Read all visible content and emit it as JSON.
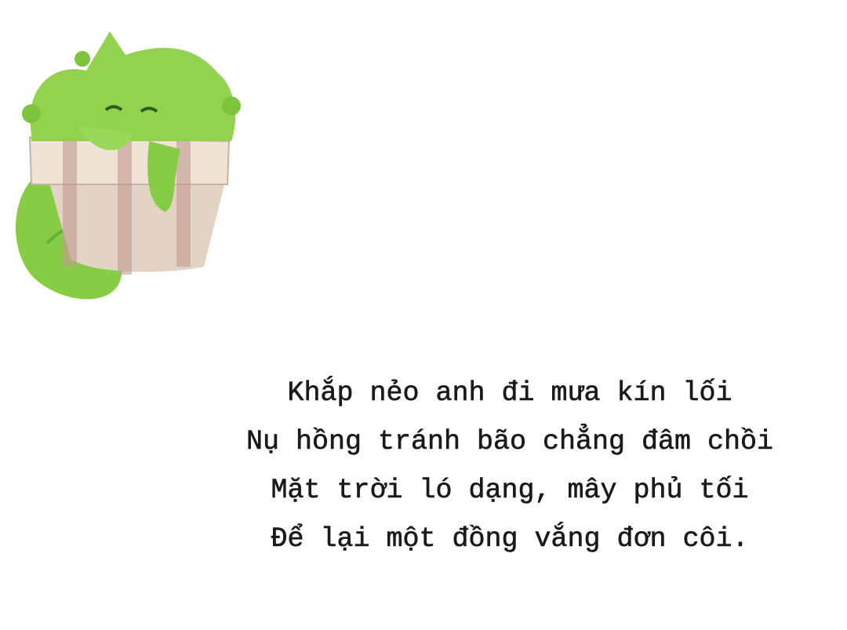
{
  "illustration": {
    "subject": "green-cat-in-flower-pot",
    "colors": {
      "cat": "#8fd14f",
      "cat_shadow": "#5fb33a",
      "pot": "#d9c7b8",
      "stripe": "#b98e86"
    }
  },
  "poem": {
    "lines": [
      "Khắp nẻo anh đi mưa kín lối",
      "Nụ hồng tránh bão chẳng đâm chồi",
      "Mặt trời ló dạng, mây phủ tối",
      "Để lại một đồng vắng đơn côi."
    ]
  }
}
